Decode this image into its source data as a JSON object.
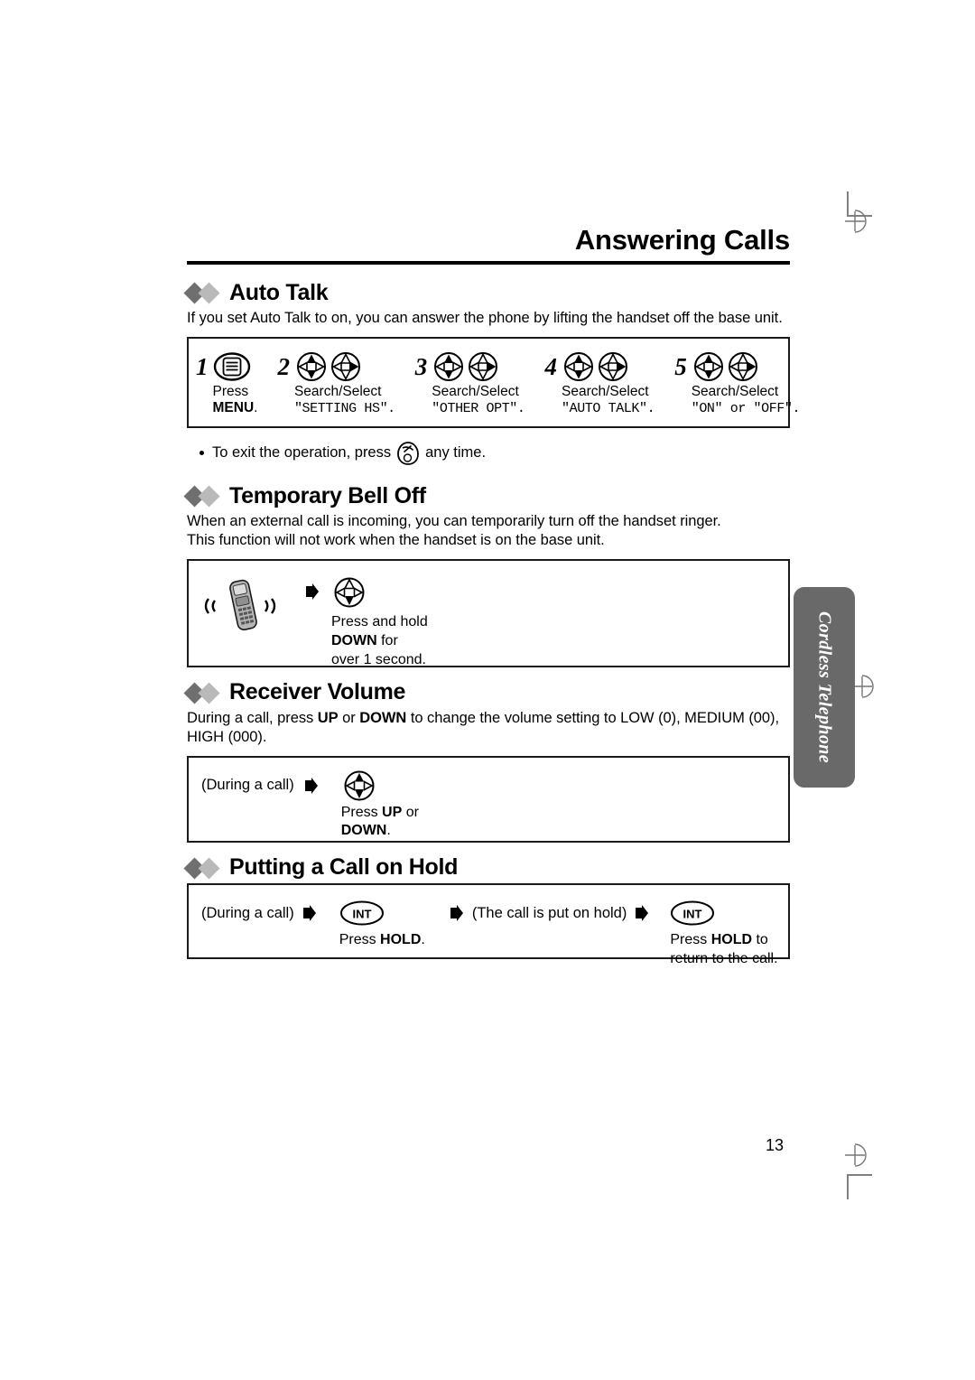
{
  "page": {
    "title": "Answering Calls",
    "number": "13",
    "side_tab_label": "Cordless Telephone"
  },
  "sections": [
    {
      "id": "auto-talk",
      "title": "Auto Talk",
      "body": "If you set Auto Talk to on, you can answer the phone by lifting the handset off the base unit.",
      "steps": [
        {
          "num": "1",
          "icon": "menu-button-icon",
          "line1": "Press",
          "line1_bold": "MENU",
          "line1_tail": ".",
          "mono": ""
        },
        {
          "num": "2",
          "icon": "navigator-up-down-right-icon",
          "line1": "Search/Select",
          "line1_bold": "",
          "line1_tail": "",
          "mono": "\"SETTING HS\"."
        },
        {
          "num": "3",
          "icon": "navigator-up-down-right-icon",
          "line1": "Search/Select",
          "line1_bold": "",
          "line1_tail": "",
          "mono": "\"OTHER OPT\"."
        },
        {
          "num": "4",
          "icon": "navigator-up-down-right-icon",
          "line1": "Search/Select",
          "line1_bold": "",
          "line1_tail": "",
          "mono": "\"AUTO TALK\"."
        },
        {
          "num": "5",
          "icon": "navigator-up-down-right-icon",
          "line1": "Search/Select",
          "line1_bold": "",
          "line1_tail": "",
          "mono": "\"ON\" or \"OFF\"."
        }
      ],
      "note_pre": "To exit the operation, press",
      "note_icon": "off-button-icon",
      "note_post": "any time."
    },
    {
      "id": "temporary-bell-off",
      "title": "Temporary Bell Off",
      "body_line1": "When an external call is incoming, you can temporarily turn off the handset ringer.",
      "body_line2": "This function will not work when the handset is on the base unit.",
      "diagram": {
        "handset_icon": "ringing-handset-icon",
        "arrow_icon": "arrow-right-icon",
        "nav_icon": "navigator-down-icon",
        "caption_line1": "Press and hold",
        "caption_bold": "DOWN",
        "caption_line2_tail": " for",
        "caption_line3": "over 1 second."
      }
    },
    {
      "id": "receiver-volume",
      "title": "Receiver Volume",
      "body_pre": "During a call, press ",
      "body_b1": "UP",
      "body_mid": " or ",
      "body_b2": "DOWN",
      "body_post": " to change the volume setting to LOW (0), MEDIUM (00), HIGH (000).",
      "diagram": {
        "step_label": "(During a call)",
        "arrow_icon": "arrow-right-icon",
        "nav_icon": "navigator-up-down-icon",
        "caption_pre": "Press ",
        "caption_b1": "UP",
        "caption_mid": " or",
        "caption_b2": "DOWN",
        "caption_tail": "."
      }
    },
    {
      "id": "putting-a-call-on-hold",
      "title": "Putting a Call on Hold",
      "diagram": {
        "step1_label": "(During a call)",
        "arrow_icon": "arrow-right-icon",
        "int_icon": "int-button-icon",
        "step2_caption_pre": "Press ",
        "step2_caption_bold": "HOLD",
        "step2_caption_tail": ".",
        "step3_label": "(The call is put on hold)",
        "step4_caption_pre": "Press ",
        "step4_caption_bold": "HOLD",
        "step4_caption_tail": " to",
        "step4_caption_line2": "return to the call."
      }
    }
  ],
  "colors": {
    "diamond_dark": "#6f6f6f",
    "diamond_light": "#b9b9b9",
    "side_tab_bg": "#696969",
    "rule": "#000000"
  }
}
